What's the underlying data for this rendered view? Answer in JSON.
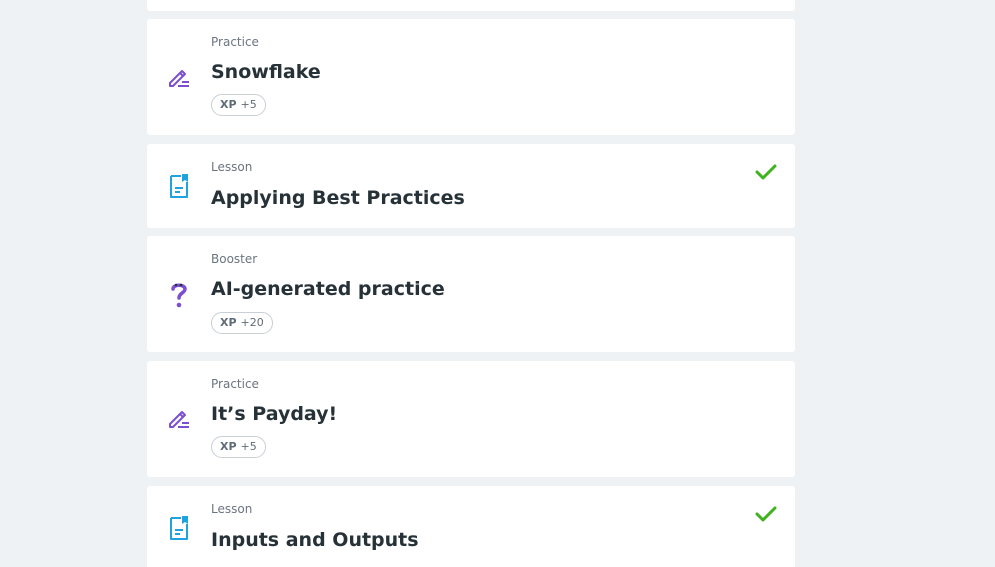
{
  "colors": {
    "background": "#eef2f5",
    "card": "#ffffff",
    "practice_icon": "#7b4fd0",
    "lesson_icon": "#1fa3e0",
    "booster_icon": "#7b4fd0",
    "check": "#3eb31d",
    "title": "#263238",
    "type": "#6b7480"
  },
  "items": [
    {
      "type": "Practice",
      "title": "Snowflake",
      "icon": "pencil-icon",
      "xp_label": "XP",
      "xp_value": "+5",
      "completed": false
    },
    {
      "type": "Lesson",
      "title": "Applying Best Practices",
      "icon": "lesson-document-icon",
      "completed": true
    },
    {
      "type": "Booster",
      "title": "AI-generated practice",
      "icon": "question-mark-icon",
      "xp_label": "XP",
      "xp_value": "+20",
      "completed": false
    },
    {
      "type": "Practice",
      "title": "It’s Payday!",
      "icon": "pencil-icon",
      "xp_label": "XP",
      "xp_value": "+5",
      "completed": false
    },
    {
      "type": "Lesson",
      "title": "Inputs and Outputs",
      "icon": "lesson-document-icon",
      "completed": true
    }
  ]
}
